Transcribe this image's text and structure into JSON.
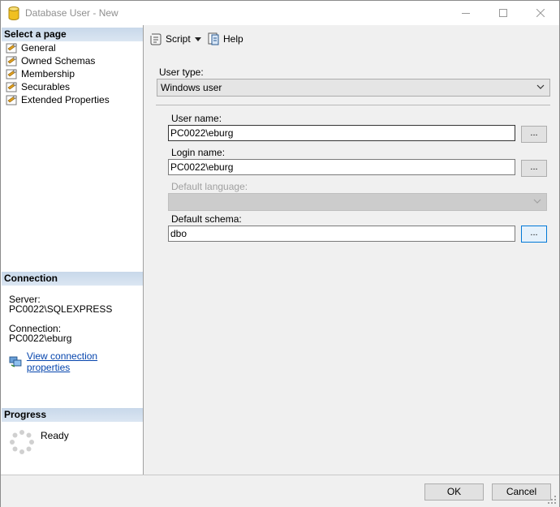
{
  "window": {
    "title": "Database User - New",
    "minimize_glyph": "—",
    "maximize_glyph": "☐",
    "close_glyph": "✕"
  },
  "left": {
    "select_page_header": "Select a page",
    "pages": [
      {
        "label": "General",
        "icon": "wrench-page-icon"
      },
      {
        "label": "Owned Schemas",
        "icon": "wrench-page-icon"
      },
      {
        "label": "Membership",
        "icon": "wrench-page-icon"
      },
      {
        "label": "Securables",
        "icon": "wrench-page-icon"
      },
      {
        "label": "Extended Properties",
        "icon": "wrench-page-icon"
      }
    ],
    "connection_header": "Connection",
    "server_label": "Server:",
    "server_value": "PC0022\\SQLEXPRESS",
    "connection_label": "Connection:",
    "connection_value": "PC0022\\eburg",
    "view_connection_link": "View connection properties",
    "progress_header": "Progress",
    "progress_status": "Ready"
  },
  "toolbar": {
    "script_label": "Script",
    "help_label": "Help"
  },
  "form": {
    "user_type_label": "User type:",
    "user_type_value": "Windows user",
    "user_name_label": "User name:",
    "user_name_value": "PC0022\\eburg",
    "login_name_label": "Login name:",
    "login_name_value": "PC0022\\eburg",
    "default_language_label": "Default language:",
    "default_language_value": "",
    "default_schema_label": "Default schema:",
    "default_schema_value": "dbo",
    "browse_label": "..."
  },
  "footer": {
    "ok_label": "OK",
    "cancel_label": "Cancel"
  },
  "colors": {
    "section_header": "#d5e1ee",
    "link": "#0645ad",
    "focus_border": "#0078d7"
  }
}
